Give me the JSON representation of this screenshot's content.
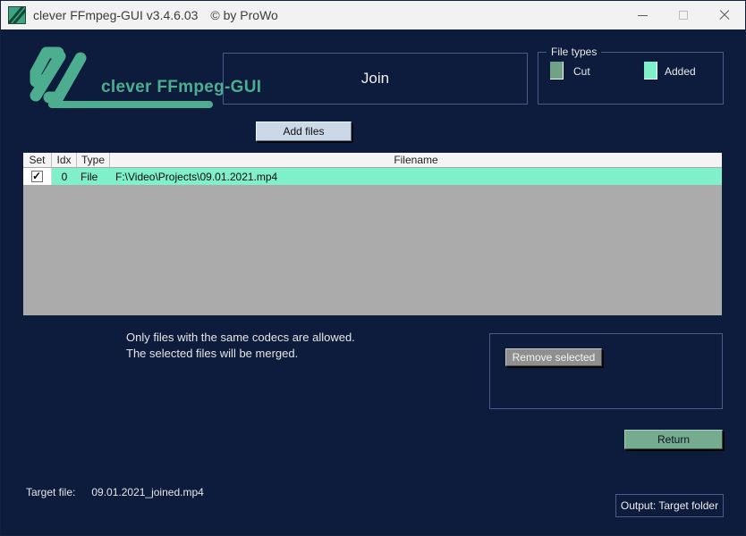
{
  "window": {
    "title": "clever FFmpeg-GUI v3.4.6.03",
    "copyright": "© by ProWo"
  },
  "icons": {
    "app": "app-logo-icon",
    "minimize": "minimize-icon",
    "maximize": "maximize-icon",
    "close": "close-icon",
    "logo": "logo-zigzag-icon"
  },
  "branding": {
    "app_name": "clever FFmpeg-GUI"
  },
  "join_panel": {
    "label": "Join"
  },
  "file_types": {
    "legend": "File types",
    "items": [
      {
        "label": "Cut",
        "color": "#6fa287"
      },
      {
        "label": "Added",
        "color": "#7ff0c9"
      }
    ]
  },
  "toolbar": {
    "add_files_label": "Add files"
  },
  "table": {
    "headers": [
      "Set",
      "Idx",
      "Type",
      "Filename"
    ],
    "rows": [
      {
        "set": true,
        "idx": "0",
        "type": "File",
        "filename": "F:\\Video\\Projects\\09.01.2021.mp4",
        "row_color": "#7ff0c9"
      }
    ]
  },
  "info": {
    "line1": "Only files with the same codecs are allowed.",
    "line2": "The selected files will be merged."
  },
  "actions": {
    "remove_selected_label": "Remove selected",
    "return_label": "Return",
    "output_label": "Output: Target folder"
  },
  "footer": {
    "target_file_label": "Target file:",
    "target_file_value": "09.01.2021_joined.mp4"
  },
  "colors": {
    "background_navy": "#0d1b3c",
    "panel_border_blue": "#4a5a8c",
    "accent_green": "#4cae8e",
    "cut_green": "#6fa287",
    "added_mint": "#7ff0c9",
    "return_green": "#75ab8e",
    "table_filler_gray": "#ababab",
    "titlebar_gray": "#f2f2f2"
  }
}
